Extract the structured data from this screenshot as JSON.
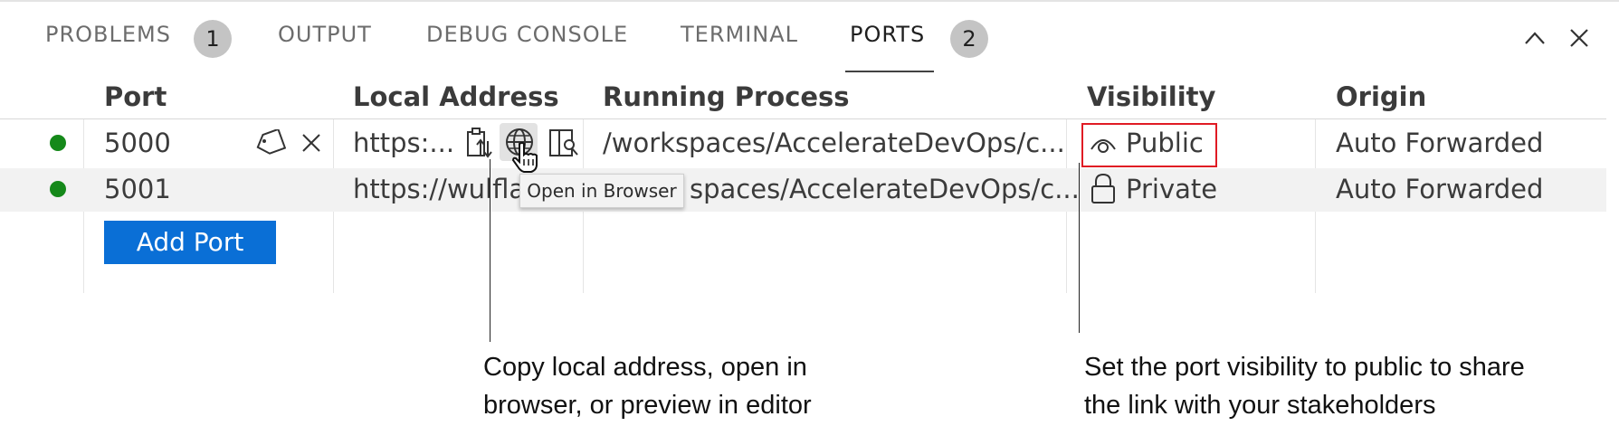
{
  "tabs": [
    {
      "label": "PROBLEMS",
      "badge": "1"
    },
    {
      "label": "OUTPUT"
    },
    {
      "label": "DEBUG CONSOLE"
    },
    {
      "label": "TERMINAL"
    },
    {
      "label": "PORTS",
      "badge": "2",
      "active": true
    }
  ],
  "icons": {
    "collapse": "chevron-up-icon",
    "close": "close-icon",
    "label": "tag-icon",
    "remove": "close-icon",
    "copy": "copy-address-icon",
    "browser": "globe-icon",
    "preview": "preview-in-editor-icon",
    "public": "eye-icon",
    "private": "lock-icon",
    "cursor": "hand-pointer-icon"
  },
  "table": {
    "headers": {
      "port": "Port",
      "address": "Local Address",
      "process": "Running Process",
      "visibility": "Visibility",
      "origin": "Origin"
    },
    "rows": [
      {
        "port": "5000",
        "address": "https:...",
        "process": "/workspaces/AccelerateDevOps/c...",
        "visibility": "Public",
        "origin": "Auto Forwarded",
        "status_color": "#15891a"
      },
      {
        "port": "5001",
        "address": "https://wulfla",
        "process": "spaces/AccelerateDevOps/c...",
        "visibility": "Private",
        "origin": "Auto Forwarded",
        "status_color": "#15891a"
      }
    ],
    "add_button": "Add Port"
  },
  "tooltip": "Open in Browser",
  "annotations": {
    "left_line1": "Copy local address, open in",
    "left_line2": "browser, or preview in editor",
    "right_line1": "Set the port visibility to public to share",
    "right_line2": "the link with your stakeholders"
  },
  "colors": {
    "accent": "#0a6fd6",
    "highlight": "#e01b24",
    "status": "#15891a"
  }
}
